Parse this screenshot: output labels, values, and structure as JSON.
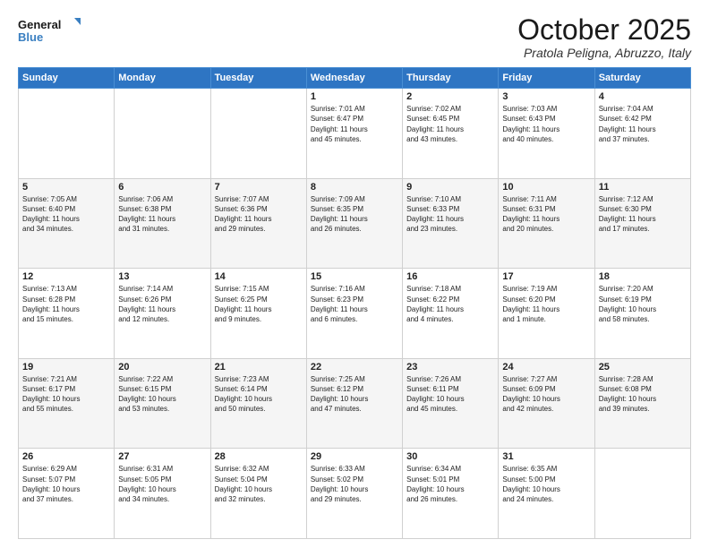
{
  "header": {
    "logo_line1": "General",
    "logo_line2": "Blue",
    "month_title": "October 2025",
    "location": "Pratola Peligna, Abruzzo, Italy"
  },
  "days_of_week": [
    "Sunday",
    "Monday",
    "Tuesday",
    "Wednesday",
    "Thursday",
    "Friday",
    "Saturday"
  ],
  "weeks": [
    [
      {
        "day": "",
        "info": ""
      },
      {
        "day": "",
        "info": ""
      },
      {
        "day": "",
        "info": ""
      },
      {
        "day": "1",
        "info": "Sunrise: 7:01 AM\nSunset: 6:47 PM\nDaylight: 11 hours\nand 45 minutes."
      },
      {
        "day": "2",
        "info": "Sunrise: 7:02 AM\nSunset: 6:45 PM\nDaylight: 11 hours\nand 43 minutes."
      },
      {
        "day": "3",
        "info": "Sunrise: 7:03 AM\nSunset: 6:43 PM\nDaylight: 11 hours\nand 40 minutes."
      },
      {
        "day": "4",
        "info": "Sunrise: 7:04 AM\nSunset: 6:42 PM\nDaylight: 11 hours\nand 37 minutes."
      }
    ],
    [
      {
        "day": "5",
        "info": "Sunrise: 7:05 AM\nSunset: 6:40 PM\nDaylight: 11 hours\nand 34 minutes."
      },
      {
        "day": "6",
        "info": "Sunrise: 7:06 AM\nSunset: 6:38 PM\nDaylight: 11 hours\nand 31 minutes."
      },
      {
        "day": "7",
        "info": "Sunrise: 7:07 AM\nSunset: 6:36 PM\nDaylight: 11 hours\nand 29 minutes."
      },
      {
        "day": "8",
        "info": "Sunrise: 7:09 AM\nSunset: 6:35 PM\nDaylight: 11 hours\nand 26 minutes."
      },
      {
        "day": "9",
        "info": "Sunrise: 7:10 AM\nSunset: 6:33 PM\nDaylight: 11 hours\nand 23 minutes."
      },
      {
        "day": "10",
        "info": "Sunrise: 7:11 AM\nSunset: 6:31 PM\nDaylight: 11 hours\nand 20 minutes."
      },
      {
        "day": "11",
        "info": "Sunrise: 7:12 AM\nSunset: 6:30 PM\nDaylight: 11 hours\nand 17 minutes."
      }
    ],
    [
      {
        "day": "12",
        "info": "Sunrise: 7:13 AM\nSunset: 6:28 PM\nDaylight: 11 hours\nand 15 minutes."
      },
      {
        "day": "13",
        "info": "Sunrise: 7:14 AM\nSunset: 6:26 PM\nDaylight: 11 hours\nand 12 minutes."
      },
      {
        "day": "14",
        "info": "Sunrise: 7:15 AM\nSunset: 6:25 PM\nDaylight: 11 hours\nand 9 minutes."
      },
      {
        "day": "15",
        "info": "Sunrise: 7:16 AM\nSunset: 6:23 PM\nDaylight: 11 hours\nand 6 minutes."
      },
      {
        "day": "16",
        "info": "Sunrise: 7:18 AM\nSunset: 6:22 PM\nDaylight: 11 hours\nand 4 minutes."
      },
      {
        "day": "17",
        "info": "Sunrise: 7:19 AM\nSunset: 6:20 PM\nDaylight: 11 hours\nand 1 minute."
      },
      {
        "day": "18",
        "info": "Sunrise: 7:20 AM\nSunset: 6:19 PM\nDaylight: 10 hours\nand 58 minutes."
      }
    ],
    [
      {
        "day": "19",
        "info": "Sunrise: 7:21 AM\nSunset: 6:17 PM\nDaylight: 10 hours\nand 55 minutes."
      },
      {
        "day": "20",
        "info": "Sunrise: 7:22 AM\nSunset: 6:15 PM\nDaylight: 10 hours\nand 53 minutes."
      },
      {
        "day": "21",
        "info": "Sunrise: 7:23 AM\nSunset: 6:14 PM\nDaylight: 10 hours\nand 50 minutes."
      },
      {
        "day": "22",
        "info": "Sunrise: 7:25 AM\nSunset: 6:12 PM\nDaylight: 10 hours\nand 47 minutes."
      },
      {
        "day": "23",
        "info": "Sunrise: 7:26 AM\nSunset: 6:11 PM\nDaylight: 10 hours\nand 45 minutes."
      },
      {
        "day": "24",
        "info": "Sunrise: 7:27 AM\nSunset: 6:09 PM\nDaylight: 10 hours\nand 42 minutes."
      },
      {
        "day": "25",
        "info": "Sunrise: 7:28 AM\nSunset: 6:08 PM\nDaylight: 10 hours\nand 39 minutes."
      }
    ],
    [
      {
        "day": "26",
        "info": "Sunrise: 6:29 AM\nSunset: 5:07 PM\nDaylight: 10 hours\nand 37 minutes."
      },
      {
        "day": "27",
        "info": "Sunrise: 6:31 AM\nSunset: 5:05 PM\nDaylight: 10 hours\nand 34 minutes."
      },
      {
        "day": "28",
        "info": "Sunrise: 6:32 AM\nSunset: 5:04 PM\nDaylight: 10 hours\nand 32 minutes."
      },
      {
        "day": "29",
        "info": "Sunrise: 6:33 AM\nSunset: 5:02 PM\nDaylight: 10 hours\nand 29 minutes."
      },
      {
        "day": "30",
        "info": "Sunrise: 6:34 AM\nSunset: 5:01 PM\nDaylight: 10 hours\nand 26 minutes."
      },
      {
        "day": "31",
        "info": "Sunrise: 6:35 AM\nSunset: 5:00 PM\nDaylight: 10 hours\nand 24 minutes."
      },
      {
        "day": "",
        "info": ""
      }
    ]
  ]
}
